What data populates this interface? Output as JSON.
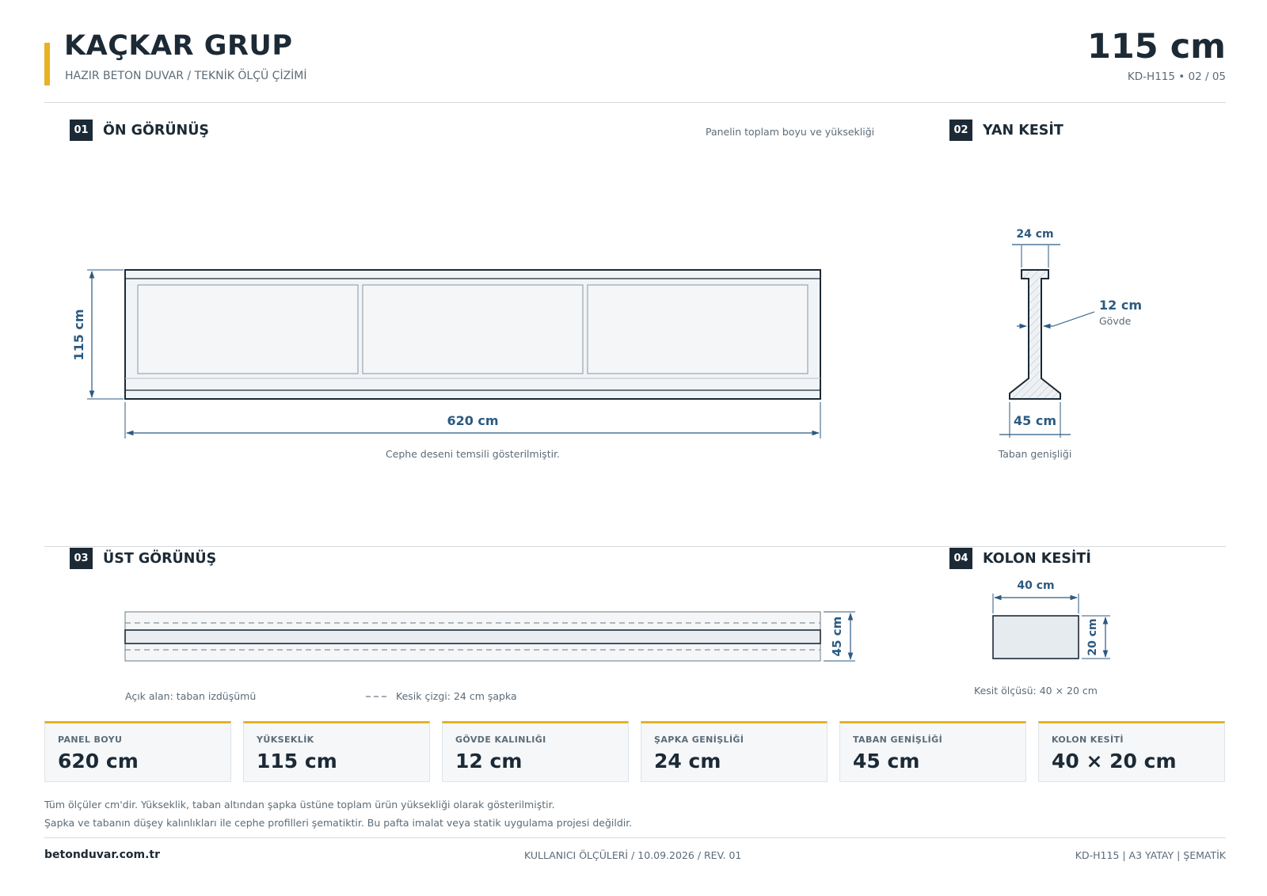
{
  "header": {
    "brand": "KAÇKAR GRUP",
    "subtitle": "HAZIR BETON DUVAR  /  TEKNİK ÖLÇÜ ÇİZİMİ",
    "height_display": "115 cm",
    "sheet_ref": "KD-H115  •  02 / 05"
  },
  "sections": {
    "front": {
      "num": "01",
      "title": "ÖN GÖRÜNÜŞ",
      "hint": "Panelin toplam boyu ve yüksekliği",
      "caption": "Cephe deseni temsili gösterilmiştir."
    },
    "side": {
      "num": "02",
      "title": "YAN KESİT",
      "caption": "Taban genişliği"
    },
    "top": {
      "num": "03",
      "title": "ÜST GÖRÜNÜŞ",
      "legend_open": "Açık alan: taban izdüşümü",
      "legend_cut": "Kesik çizgi: 24 cm şapka"
    },
    "column": {
      "num": "04",
      "title": "KOLON KESİTİ",
      "caption": "Kesit ölçüsü: 40 × 20 cm"
    }
  },
  "dims": {
    "front_height": "115 cm",
    "front_length": "620 cm",
    "cap_width": "24 cm",
    "body_thickness": "12 cm",
    "body_label": "Gövde",
    "base_width": "45 cm",
    "top_width": "45 cm",
    "column_width": "40 cm",
    "column_depth": "20 cm"
  },
  "specs": [
    {
      "label": "PANEL BOYU",
      "value": "620 cm"
    },
    {
      "label": "YÜKSEKLİK",
      "value": "115 cm"
    },
    {
      "label": "GÖVDE KALINLIĞI",
      "value": "12 cm"
    },
    {
      "label": "ŞAPKA GENİŞLİĞİ",
      "value": "24 cm"
    },
    {
      "label": "TABAN GENİŞLİĞİ",
      "value": "45 cm"
    },
    {
      "label": "KOLON KESİTİ",
      "value": "40 × 20 cm"
    }
  ],
  "notes": [
    "Tüm ölçüler cm'dir. Yükseklik, taban altından şapka üstüne toplam ürün yüksekliği olarak gösterilmiştir.",
    "Şapka ve tabanın düşey kalınlıkları ile cephe profilleri şematiktir. Bu pafta imalat veya statik uygulama projesi değildir."
  ],
  "footer": {
    "website": "betonduvar.com.tr",
    "meta": "KULLANICI ÖLÇÜLERİ  /  10.09.2026  /  REV. 01",
    "code": "KD-H115  |  A3 YATAY  |  ŞEMATİK"
  },
  "colors": {
    "accent": "#e6b325",
    "ink": "#1c2a36",
    "dimension": "#2c5a80",
    "panel_fill": "#f1f4f7"
  }
}
